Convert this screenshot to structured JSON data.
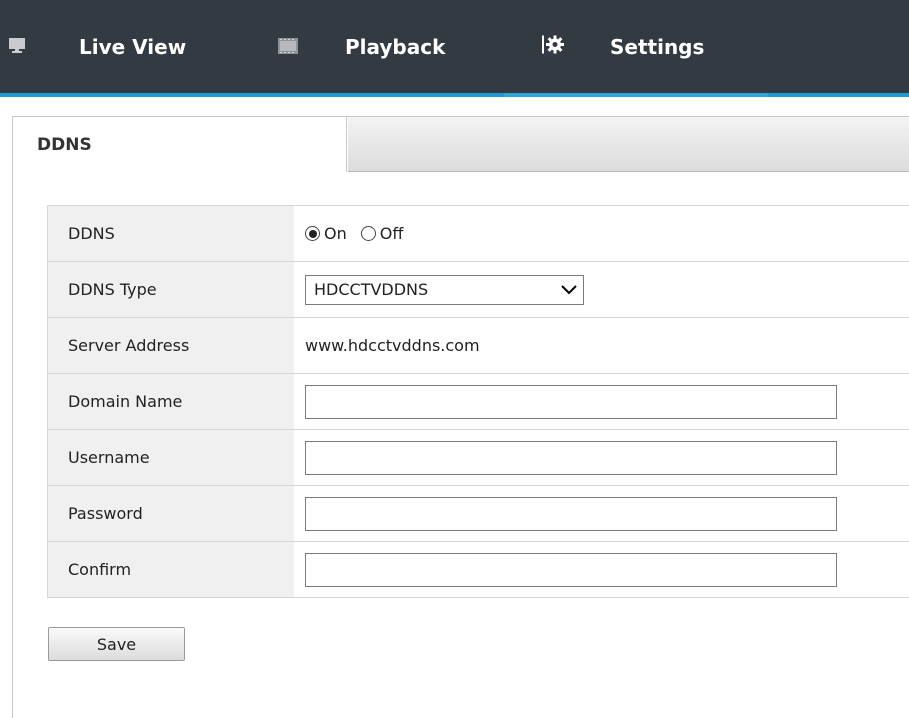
{
  "nav": {
    "items": [
      {
        "label": "Live View",
        "icon": "monitor-icon"
      },
      {
        "label": "Playback",
        "icon": "film-icon"
      },
      {
        "label": "Settings",
        "icon": "gear-icon"
      }
    ],
    "active": "Settings",
    "colors": {
      "bar": "#333a42",
      "accent": "#1b9bd6"
    }
  },
  "tabs": {
    "active_label": "DDNS"
  },
  "form": {
    "ddns": {
      "label": "DDNS",
      "options": [
        "On",
        "Off"
      ],
      "selected": "On"
    },
    "ddns_type": {
      "label": "DDNS Type",
      "value": "HDCCTVDDNS"
    },
    "server_address": {
      "label": "Server Address",
      "value": "www.hdcctvddns.com"
    },
    "domain_name": {
      "label": "Domain Name",
      "value": ""
    },
    "username": {
      "label": "Username",
      "value": ""
    },
    "password": {
      "label": "Password",
      "value": ""
    },
    "confirm": {
      "label": "Confirm",
      "value": ""
    }
  },
  "save_label": "Save"
}
